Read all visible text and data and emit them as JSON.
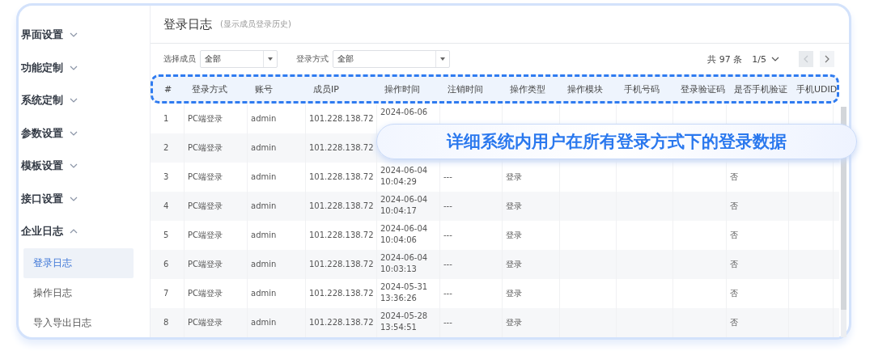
{
  "sidebar": {
    "items": [
      {
        "label": "界面设置",
        "expanded": false
      },
      {
        "label": "功能定制",
        "expanded": false
      },
      {
        "label": "系统定制",
        "expanded": false
      },
      {
        "label": "参数设置",
        "expanded": false
      },
      {
        "label": "模板设置",
        "expanded": false
      },
      {
        "label": "接口设置",
        "expanded": false
      },
      {
        "label": "企业日志",
        "expanded": true,
        "children": [
          {
            "label": "登录日志",
            "selected": true
          },
          {
            "label": "操作日志",
            "selected": false
          },
          {
            "label": "导入导出日志",
            "selected": false
          }
        ]
      }
    ]
  },
  "page": {
    "title": "登录日志",
    "subtitle": "(显示成员登录历史)"
  },
  "filters": [
    {
      "label": "选择成员",
      "value": "全部"
    },
    {
      "label": "登录方式",
      "value": "全部"
    }
  ],
  "pagination": {
    "total": "共 97 条",
    "page": "1/5",
    "prev_disabled": true,
    "next_disabled": false
  },
  "table": {
    "columns": [
      "#",
      "登录方式",
      "账号",
      "成员IP",
      "操作时间",
      "注销时间",
      "操作类型",
      "操作模块",
      "手机号码",
      "登录验证码",
      "是否手机验证",
      "手机UDID"
    ],
    "rows": [
      {
        "no": "1",
        "method": "PC端登录",
        "account": "admin",
        "ip": "101.228.138.72",
        "time": "2024-06-06"
      },
      {
        "no": "2",
        "method": "PC端登录",
        "account": "admin",
        "ip": "101.228.138.72"
      },
      {
        "no": "3",
        "method": "PC端登录",
        "account": "admin",
        "ip": "101.228.138.72",
        "time": "2024-06-04 10:04:29",
        "logout": "---",
        "type": "登录",
        "phone_verify": "否"
      },
      {
        "no": "4",
        "method": "PC端登录",
        "account": "admin",
        "ip": "101.228.138.72",
        "time": "2024-06-04 10:04:17",
        "logout": "---",
        "type": "登录",
        "phone_verify": "否"
      },
      {
        "no": "5",
        "method": "PC端登录",
        "account": "admin",
        "ip": "101.228.138.72",
        "time": "2024-06-04 10:04:06",
        "logout": "---",
        "type": "登录",
        "phone_verify": "否"
      },
      {
        "no": "6",
        "method": "PC端登录",
        "account": "admin",
        "ip": "101.228.138.72",
        "time": "2024-06-04 10:03:13",
        "logout": "---",
        "type": "登录",
        "phone_verify": "否"
      },
      {
        "no": "7",
        "method": "PC端登录",
        "account": "admin",
        "ip": "101.228.138.72",
        "time": "2024-05-31 13:36:26",
        "logout": "---",
        "type": "登录",
        "phone_verify": "否"
      },
      {
        "no": "8",
        "method": "PC端登录",
        "account": "admin",
        "ip": "101.228.138.72",
        "time": "2024-05-28 13:54:51",
        "logout": "---",
        "type": "登录",
        "phone_verify": "否"
      }
    ]
  },
  "banner": {
    "text": "详细系统内用户在所有登录方式下的登录数据"
  }
}
